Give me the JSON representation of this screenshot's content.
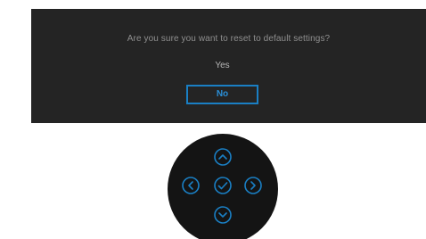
{
  "dialog": {
    "prompt": "Are you sure you want to reset to default settings?",
    "options": [
      {
        "label": "Yes",
        "selected": false
      },
      {
        "label": "No",
        "selected": true
      }
    ]
  },
  "joystick": {
    "buttons": [
      "up-icon",
      "left-icon",
      "confirm-check-icon",
      "right-icon",
      "down-icon"
    ]
  },
  "colors": {
    "panel_background": "#242424",
    "prompt_text": "#8f8f8f",
    "option_text": "#b8b8b8",
    "selection_accent": "#1a7fc4",
    "joystick_body": "#141414"
  }
}
